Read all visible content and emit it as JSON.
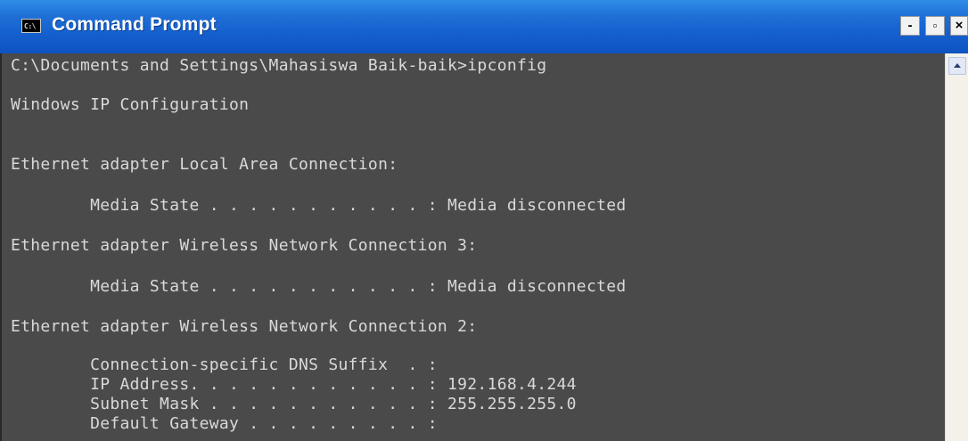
{
  "window": {
    "title": "Command Prompt",
    "icon_text": "C:\\",
    "buttons": {
      "minimize": "-",
      "restore": "▫",
      "close": "×"
    }
  },
  "console": {
    "lines": [
      "C:\\Documents and Settings\\Mahasiswa Baik-baik>ipconfig",
      "Windows IP Configuration",
      "Ethernet adapter Local Area Connection:",
      "        Media State . . . . . . . . . . . : Media disconnected",
      "Ethernet adapter Wireless Network Connection 3:",
      "        Media State . . . . . . . . . . . : Media disconnected",
      "Ethernet adapter Wireless Network Connection 2:",
      "        Connection-specific DNS Suffix  . :",
      "        IP Address. . . . . . . . . . . . : 192.168.4.244",
      "        Subnet Mask . . . . . . . . . . . : 255.255.255.0",
      "        Default Gateway . . . . . . . . . :"
    ]
  },
  "icons": {
    "window_icon": "command-prompt-icon",
    "scroll_up": "scroll-up-arrow-icon"
  }
}
